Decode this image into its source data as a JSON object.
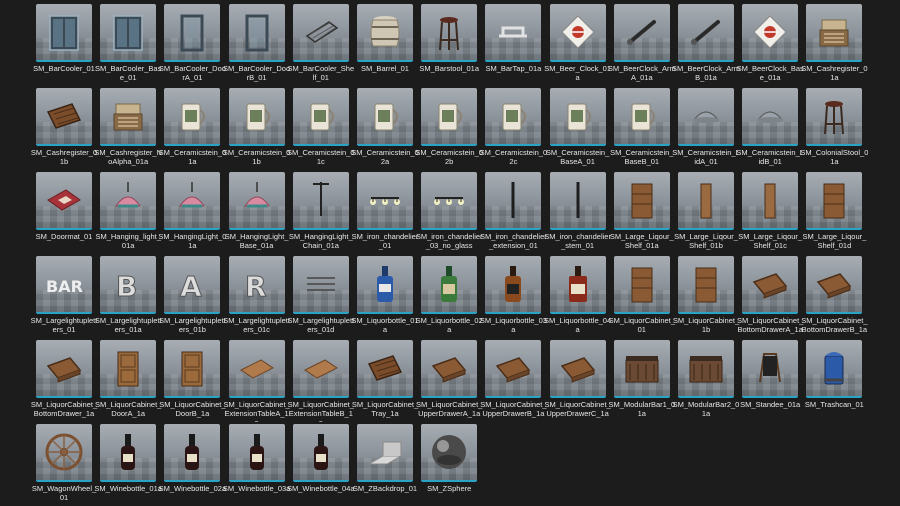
{
  "assets": [
    {
      "label": "SM_BarCooler_01",
      "icon": "fridge-icon"
    },
    {
      "label": "SM_BarCooler_Base_01",
      "icon": "fridge-icon"
    },
    {
      "label": "SM_BarCooler_DoorA_01",
      "icon": "door-icon"
    },
    {
      "label": "SM_BarCooler_DoorB_01",
      "icon": "door-icon"
    },
    {
      "label": "SM_BarCooler_Shelf_01",
      "icon": "shelf-icon"
    },
    {
      "label": "SM_Barrel_01",
      "icon": "barrel-icon"
    },
    {
      "label": "SM_Barstool_01a",
      "icon": "stool-icon"
    },
    {
      "label": "SM_BarTap_01a",
      "icon": "tap-icon"
    },
    {
      "label": "SM_Beer_Clock_01a",
      "icon": "clock-icon"
    },
    {
      "label": "SM_BeerClock_ArmA_01a",
      "icon": "arm-icon"
    },
    {
      "label": "SM_BeerClock_ArmB_01a",
      "icon": "arm-icon"
    },
    {
      "label": "SM_BeerClock_Base_01a",
      "icon": "clock-icon"
    },
    {
      "label": "SM_Cashregister_01a",
      "icon": "register-icon"
    },
    {
      "label": "SM_Cashregister_01b",
      "icon": "tray-icon"
    },
    {
      "label": "SM_Cashregister_NoAlpha_01a",
      "icon": "register-icon"
    },
    {
      "label": "SM_Ceramicstein_01a",
      "icon": "stein-icon"
    },
    {
      "label": "SM_Ceramicstein_01b",
      "icon": "stein-icon"
    },
    {
      "label": "SM_Ceramicstein_01c",
      "icon": "stein-icon"
    },
    {
      "label": "SM_Ceramicstein_02a",
      "icon": "stein-icon"
    },
    {
      "label": "SM_Ceramicstein_02b",
      "icon": "stein-icon"
    },
    {
      "label": "SM_Ceramicstein_02c",
      "icon": "stein-icon"
    },
    {
      "label": "SM_Ceramicstein_BaseA_01",
      "icon": "stein-icon"
    },
    {
      "label": "SM_Ceramicstein_BaseB_01",
      "icon": "stein-icon"
    },
    {
      "label": "SM_Ceramicstein_LidA_01",
      "icon": "lid-icon"
    },
    {
      "label": "SM_Ceramicstein_LidB_01",
      "icon": "lid-icon"
    },
    {
      "label": "SM_ColonialStool_01a",
      "icon": "stool-icon"
    },
    {
      "label": "SM_Doormat_01",
      "icon": "mat-icon"
    },
    {
      "label": "SM_Hanging_light_01a",
      "icon": "lamp-icon"
    },
    {
      "label": "SM_HangingLight_01a",
      "icon": "lamp-icon"
    },
    {
      "label": "SM_HangingLight_Base_01a",
      "icon": "lamp-icon"
    },
    {
      "label": "SM_HangingLight_Chain_01a",
      "icon": "chain-icon"
    },
    {
      "label": "SM_iron_chandelier_01",
      "icon": "chandelier-icon"
    },
    {
      "label": "SM_iron_chandelier_03_no_glass",
      "icon": "chandelier-icon"
    },
    {
      "label": "SM_iron_chandelier_extension_01",
      "icon": "pole-icon"
    },
    {
      "label": "SM_iron_chandelier_stem_01",
      "icon": "pole-icon"
    },
    {
      "label": "SM_Large_Liqour_Shelf_01a",
      "icon": "cabinet-icon"
    },
    {
      "label": "SM_Large_Liqour_Shelf_01b",
      "icon": "plank-icon"
    },
    {
      "label": "SM_Large_Liqour_Shelf_01c",
      "icon": "plank-icon"
    },
    {
      "label": "SM_Large_Liqour_Shelf_01d",
      "icon": "cabinet-icon"
    },
    {
      "label": "SM_Largelightupletters_01",
      "icon": "letters-icon"
    },
    {
      "label": "SM_Largelightupletters_01a",
      "icon": "letter-b-icon"
    },
    {
      "label": "SM_Largelightupletters_01b",
      "icon": "letter-a-icon"
    },
    {
      "label": "SM_Largelightupletters_01c",
      "icon": "letter-r-icon"
    },
    {
      "label": "SM_Largelightupletters_01d",
      "icon": "rods-icon"
    },
    {
      "label": "SM_Liquorbottle_01a",
      "icon": "bottle-blue-icon"
    },
    {
      "label": "SM_Liquorbottle_02a",
      "icon": "bottle-green-icon"
    },
    {
      "label": "SM_Liquorbottle_03a",
      "icon": "bottle-amber-icon"
    },
    {
      "label": "SM_Liquorbottle_04a",
      "icon": "bottle-red-icon"
    },
    {
      "label": "SM_LiquorCabinet_01",
      "icon": "cabinet-icon"
    },
    {
      "label": "SM_LiquorCabinet_1b",
      "icon": "cabinet-icon"
    },
    {
      "label": "SM_LiquorCabinet_BottomDrawerA_1a",
      "icon": "drawer-icon"
    },
    {
      "label": "SM_LiquorCabinet_BottomDrawerB_1a",
      "icon": "drawer-icon"
    },
    {
      "label": "SM_LiquorCabinet_BottomDrawer_1a",
      "icon": "drawer-icon"
    },
    {
      "label": "SM_LiquorCabinet_DoorA_1a",
      "icon": "wooden-door-icon"
    },
    {
      "label": "SM_LiquorCabinet_DoorB_1a",
      "icon": "wooden-door-icon"
    },
    {
      "label": "SM_LiquorCabinet_ExtensionTableA_1a",
      "icon": "board-icon"
    },
    {
      "label": "SM_LiquorCabinet_ExtensionTableB_1a",
      "icon": "board-icon"
    },
    {
      "label": "SM_LiquorCabinet_Tray_1a",
      "icon": "tray-icon"
    },
    {
      "label": "SM_LiquorCabinet_UpperDrawerA_1a",
      "icon": "drawer-icon"
    },
    {
      "label": "SM_LiquorCabinet_UpperDrawerB_1a",
      "icon": "drawer-icon"
    },
    {
      "label": "SM_LiquorCabinet_UpperDrawerC_1a",
      "icon": "drawer-icon"
    },
    {
      "label": "SM_ModularBar1_01a",
      "icon": "bar-counter-icon"
    },
    {
      "label": "SM_ModularBar2_01a",
      "icon": "bar-counter-icon"
    },
    {
      "label": "SM_Standee_01a",
      "icon": "standee-icon"
    },
    {
      "label": "SM_Trashcan_01",
      "icon": "trashcan-icon"
    },
    {
      "label": "SM_WagonWheel_01",
      "icon": "wheel-icon"
    },
    {
      "label": "SM_Winebottle_01a",
      "icon": "wine-bottle-icon"
    },
    {
      "label": "SM_Winebottle_02a",
      "icon": "wine-bottle-icon"
    },
    {
      "label": "SM_Winebottle_03a",
      "icon": "wine-bottle-icon"
    },
    {
      "label": "SM_Winebottle_04a",
      "icon": "wine-bottle-icon"
    },
    {
      "label": "SM_ZBackdrop_01",
      "icon": "backdrop-icon"
    },
    {
      "label": "SM_ZSphere",
      "icon": "sphere-icon"
    }
  ],
  "colors": {
    "background": "#1c1c1c",
    "label": "#e6e6e6",
    "accent": "#2aa3c4"
  }
}
